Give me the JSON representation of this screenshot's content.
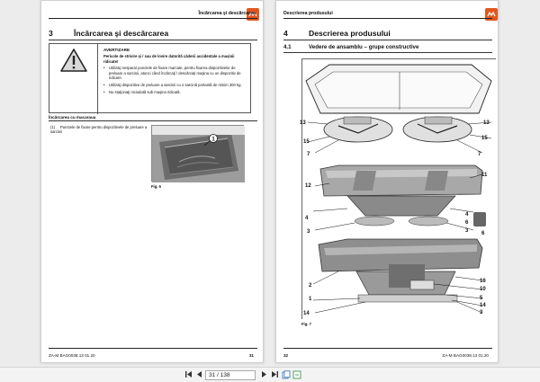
{
  "left_page": {
    "header_title": "Încărcarea şi descărcarea",
    "chapter_number": "3",
    "chapter_title": "Încărcarea şi descărcarea",
    "warning": {
      "title": "AVERTIZARE",
      "lead": "Pericole de strivire şi / sau de lovire datorită căderii accidentale a maşinii ridicate!",
      "bullets": [
        "Utilizaţi nesparat punctele de fixare marcate, pentru fixarea dispozitivelor de preluare a sarcinii, atunci când încărcaţi / descărcaţi maşina cu un dispozitiv de ridicare.",
        "Utilizaţi dispozitive de preluare a sarcinii cu o sarcină portantă de minim 300 kg.",
        "Nu staţionaţi niciodată sub maşina ridicată."
      ]
    },
    "subsection": "Încărcarea cu macaraua",
    "step_number": "(1)",
    "step_text": "Punctele de fixare pentru dispozitivele de preluare a sarcinii",
    "fig_label": "Fig. 6",
    "fig_callout": "1",
    "footer_left": "ZA-M  BAG0038.13  01.20",
    "page_number": "31"
  },
  "right_page": {
    "header_title": "Descrierea produsului",
    "chapter_number": "4",
    "chapter_title": "Descrierea produsului",
    "section_number": "4.1",
    "section_title": "Vedere de ansamblu – grupe constructive",
    "fig_label": "Fig. 7",
    "footer_page_number": "32",
    "footer_right": "ZA-M  BAG0038.13  01.20",
    "callouts_top": [
      "13",
      "15",
      "7",
      "13",
      "15",
      "7"
    ],
    "callouts_mid": [
      "12",
      "11",
      "4",
      "3",
      "4",
      "6",
      "3",
      "6"
    ],
    "callouts_bottom": [
      "2",
      "1",
      "14",
      "16",
      "10",
      "5",
      "14",
      "3"
    ]
  },
  "toolbar": {
    "current_page": "31 / 138"
  },
  "colors": {
    "logo": "#e2561e",
    "page_bg": "#ffffff",
    "viewer_bg": "#ececec"
  }
}
